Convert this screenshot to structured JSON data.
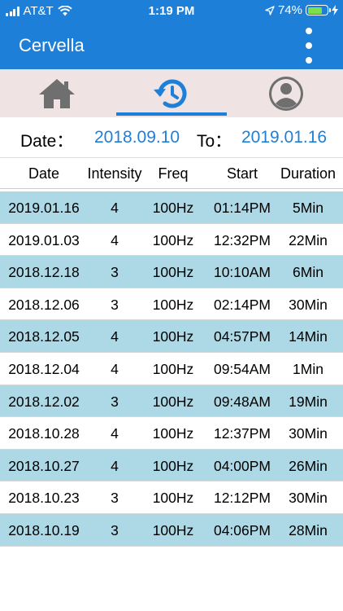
{
  "status_bar": {
    "carrier": "AT&T",
    "time": "1:19 PM",
    "battery_percent": "74%",
    "battery_level": 0.74,
    "icons": [
      "signal-bars-icon",
      "wifi-icon",
      "location-arrow-icon",
      "battery-icon",
      "charging-bolt-icon"
    ]
  },
  "app_bar": {
    "title": "Cervella",
    "menu_icon": "more-vertical-icon"
  },
  "tabs": [
    {
      "name": "home",
      "icon": "home-icon",
      "active": false
    },
    {
      "name": "history",
      "icon": "history-icon",
      "active": true
    },
    {
      "name": "profile",
      "icon": "user-icon",
      "active": false
    }
  ],
  "filter": {
    "date_label": "Date：",
    "from_date": "2018.09.10",
    "to_label": "To：",
    "to_date": "2019.01.16"
  },
  "table": {
    "headers": [
      "Date",
      "Intensity",
      "Freq",
      "Start",
      "Duration"
    ],
    "rows": [
      [
        "2019.01.16",
        "4",
        "100Hz",
        "01:14PM",
        "5Min"
      ],
      [
        "2019.01.03",
        "4",
        "100Hz",
        "12:32PM",
        "22Min"
      ],
      [
        "2018.12.18",
        "3",
        "100Hz",
        "10:10AM",
        "6Min"
      ],
      [
        "2018.12.06",
        "3",
        "100Hz",
        "02:14PM",
        "30Min"
      ],
      [
        "2018.12.05",
        "4",
        "100Hz",
        "04:57PM",
        "14Min"
      ],
      [
        "2018.12.04",
        "4",
        "100Hz",
        "09:54AM",
        "1Min"
      ],
      [
        "2018.12.02",
        "3",
        "100Hz",
        "09:48AM",
        "19Min"
      ],
      [
        "2018.10.28",
        "4",
        "100Hz",
        "12:37PM",
        "30Min"
      ],
      [
        "2018.10.27",
        "4",
        "100Hz",
        "04:00PM",
        "26Min"
      ],
      [
        "2018.10.23",
        "3",
        "100Hz",
        "12:12PM",
        "30Min"
      ],
      [
        "2018.10.19",
        "3",
        "100Hz",
        "04:06PM",
        "28Min"
      ]
    ]
  },
  "colors": {
    "primary": "#1e7fd9",
    "tab_background": "#efe3e3",
    "row_highlight": "#add8e6",
    "battery_fill": "#7be04a",
    "icon_gray": "#6f6f6f"
  }
}
